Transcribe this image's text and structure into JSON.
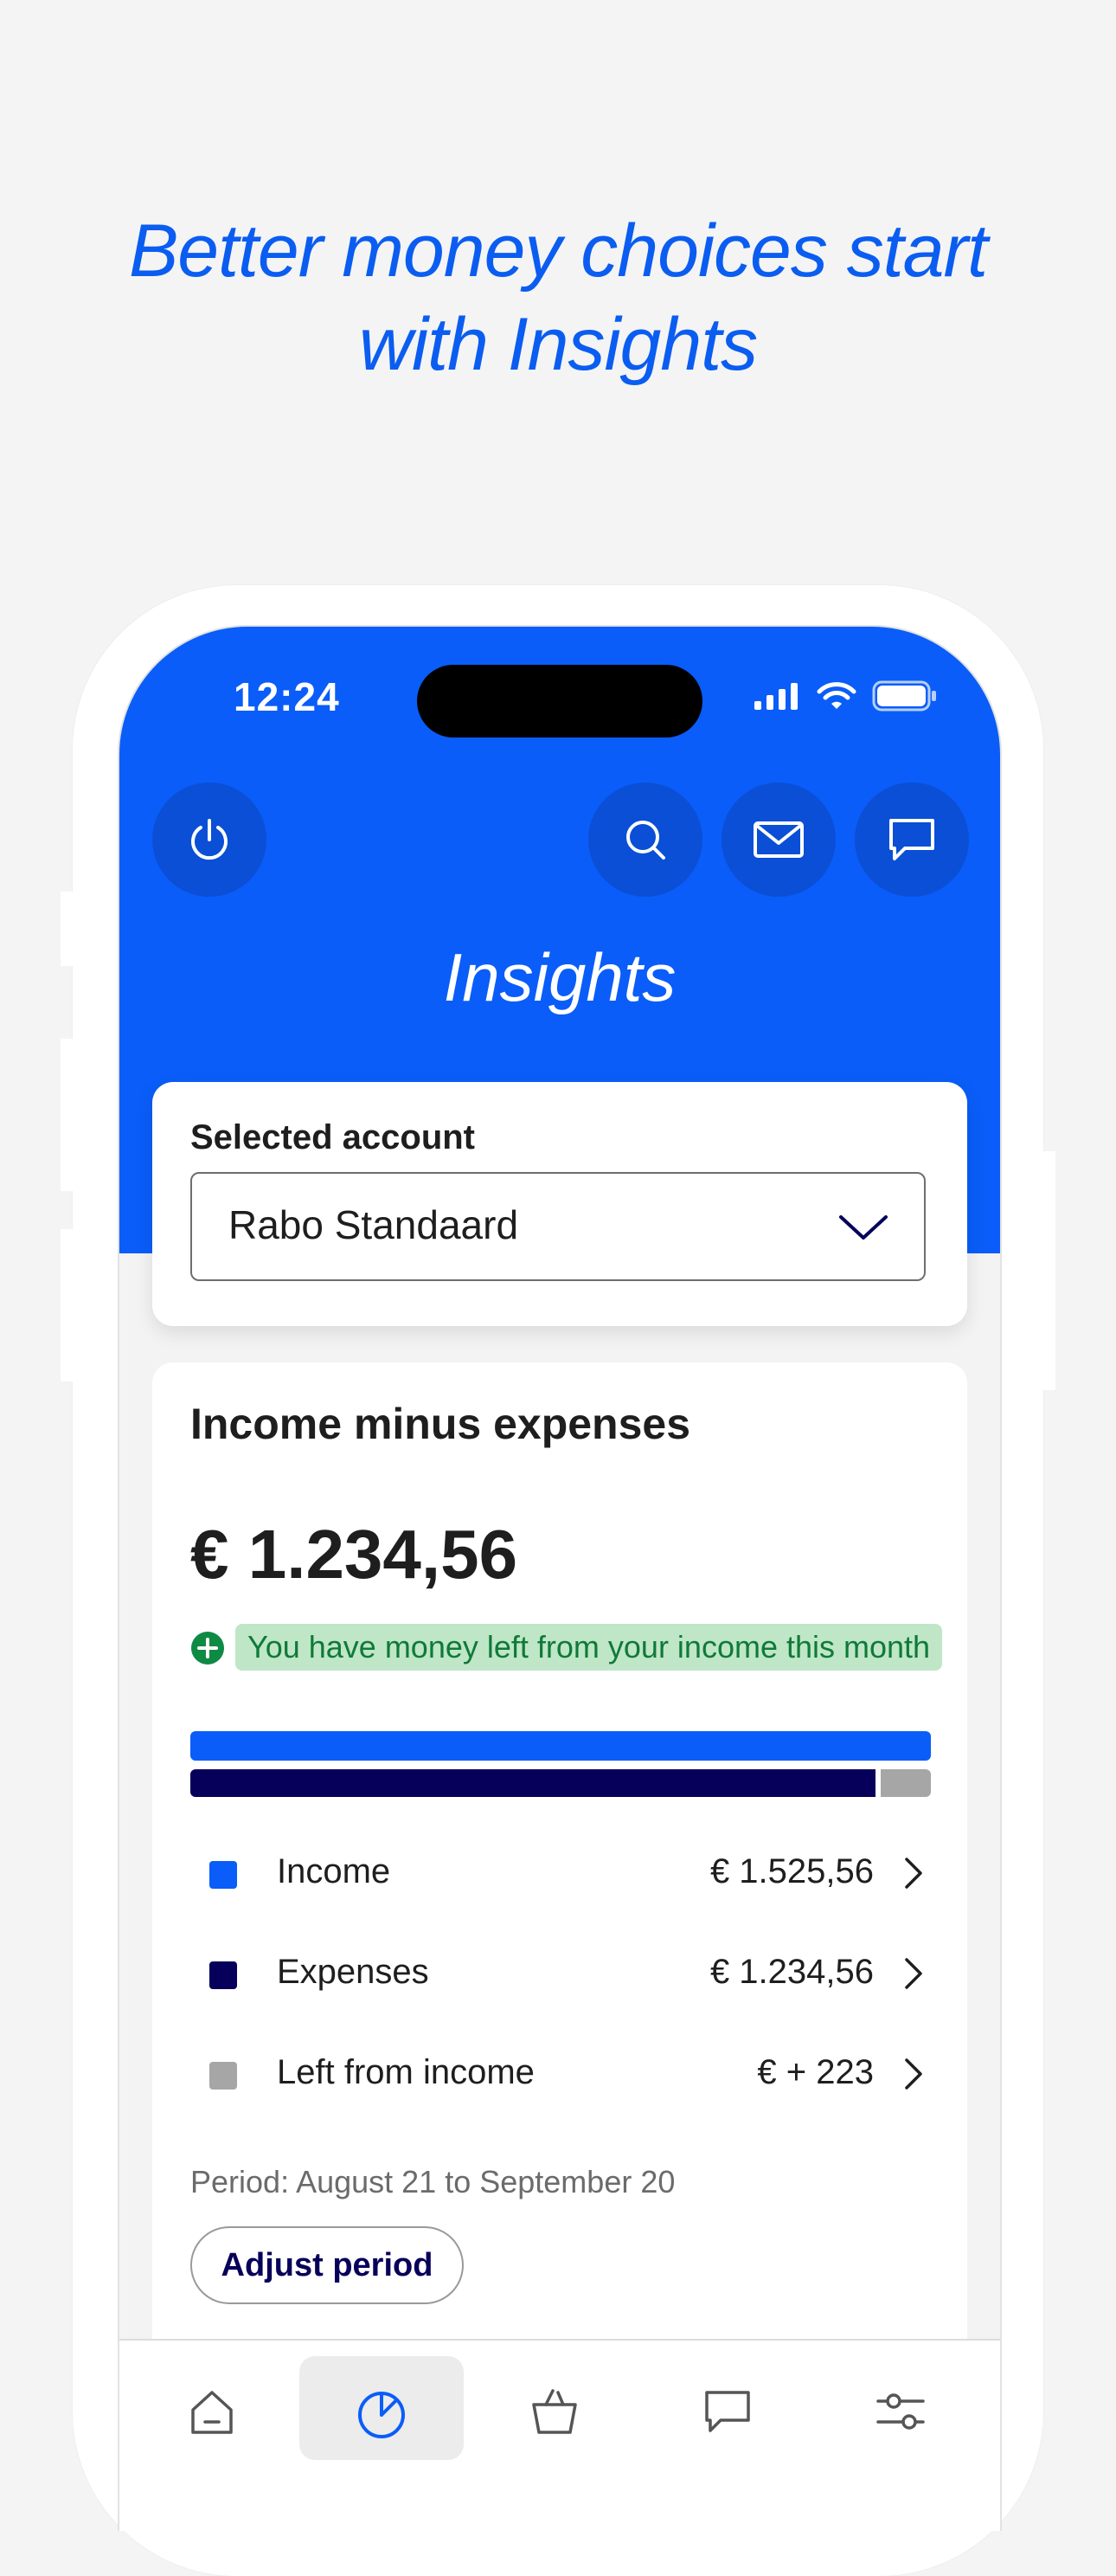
{
  "headline": {
    "line1": "Better money choices start",
    "line2": "with Insights"
  },
  "status_bar": {
    "time": "12:24"
  },
  "header": {
    "title": "Insights",
    "icons": [
      "power-icon",
      "search-icon",
      "mail-icon",
      "chat-icon"
    ]
  },
  "account": {
    "label": "Selected account",
    "selected": "Rabo Standaard"
  },
  "summary": {
    "title": "Income minus expenses",
    "amount": "€ 1.234,56",
    "note": "You have money left from your income this month",
    "expenses_share": 0.925
  },
  "legend": [
    {
      "label": "Income",
      "value": "€ 1.525,56",
      "color": "#0a5df8"
    },
    {
      "label": "Expenses",
      "value": "€ 1.234,56",
      "color": "#07005a"
    },
    {
      "label": "Left from income",
      "value": "€ + 223",
      "color": "#a6a6a6"
    }
  ],
  "period": {
    "text": "Period: August 21 to September 20",
    "button_label": "Adjust period"
  },
  "tabbar": {
    "active": "insights",
    "icons": [
      "home-icon",
      "insights-pie-icon",
      "basket-icon",
      "chat-icon",
      "settings-sliders-icon"
    ]
  },
  "colors": {
    "brand_blue": "#0a5df8",
    "navy": "#07005a",
    "positive_green": "#0f7a38"
  }
}
